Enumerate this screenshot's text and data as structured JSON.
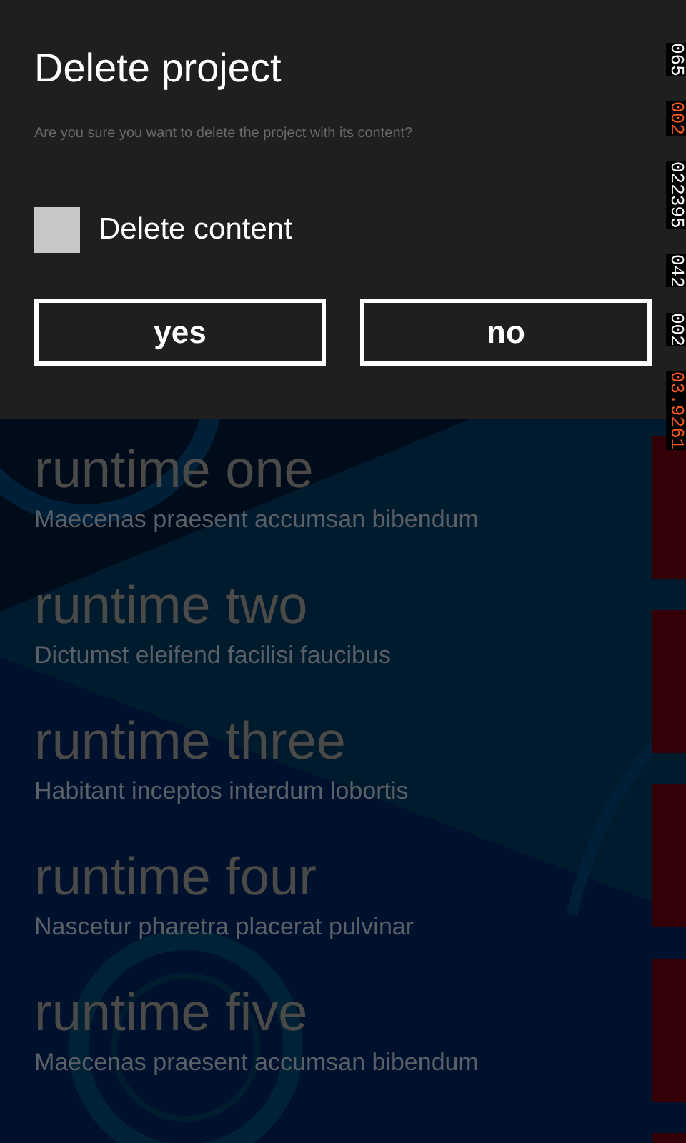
{
  "dialog": {
    "title": "Delete project",
    "message": "Are you sure you want to delete the project with its content?",
    "checkbox": {
      "label": "Delete content",
      "checked": false
    },
    "buttons": [
      "yes",
      "no"
    ]
  },
  "list": [
    {
      "title": "runtime one",
      "subtitle": "Maecenas praesent accumsan bibendum"
    },
    {
      "title": "runtime two",
      "subtitle": "Dictumst eleifend facilisi faucibus"
    },
    {
      "title": "runtime three",
      "subtitle": "Habitant inceptos interdum lobortis"
    },
    {
      "title": "runtime four",
      "subtitle": "Nascetur pharetra placerat pulvinar"
    },
    {
      "title": "runtime five",
      "subtitle": "Maecenas praesent accumsan bibendum"
    }
  ],
  "frame_counters": [
    {
      "text": "065",
      "kind": "normal"
    },
    {
      "text": "002",
      "kind": "alert"
    },
    {
      "text": "022395",
      "kind": "normal"
    },
    {
      "text": "042",
      "kind": "normal"
    },
    {
      "text": "002",
      "kind": "normal"
    },
    {
      "text": "03.9261",
      "kind": "alert"
    }
  ]
}
